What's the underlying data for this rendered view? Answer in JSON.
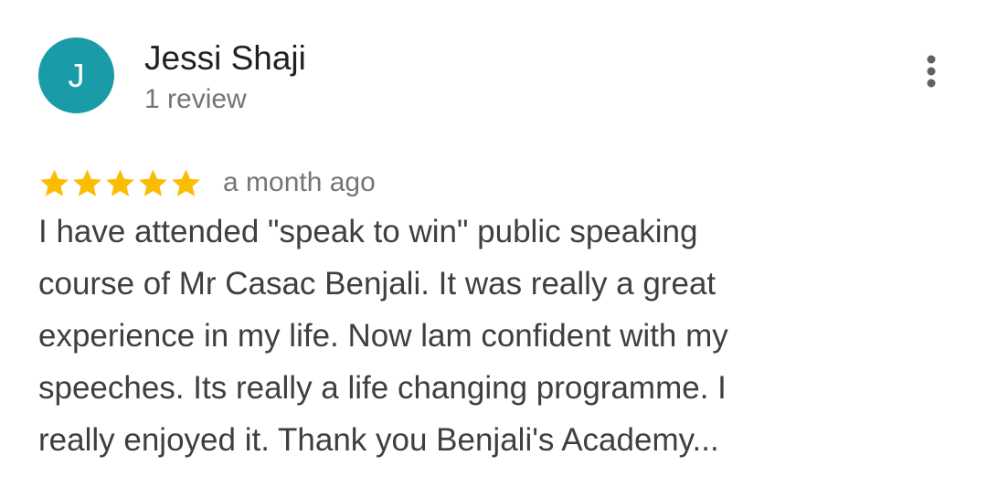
{
  "review": {
    "avatar": {
      "initial": "J",
      "color": "#1a9ca8"
    },
    "author": "Jessi Shaji",
    "review_count": "1 review",
    "rating": 5,
    "max_rating": 5,
    "star_color": "#fbbc04",
    "date": "a month ago",
    "text_lines": [
      "I have attended \"speak to win\" public speaking",
      "course of Mr Casac Benjali. It was really a great",
      "experience in my life. Now lam confident with my",
      "speeches. Its really a life changing programme. I",
      "really enjoyed it. Thank you Benjali's Academy..."
    ],
    "more_icon": "more-vert-icon"
  }
}
